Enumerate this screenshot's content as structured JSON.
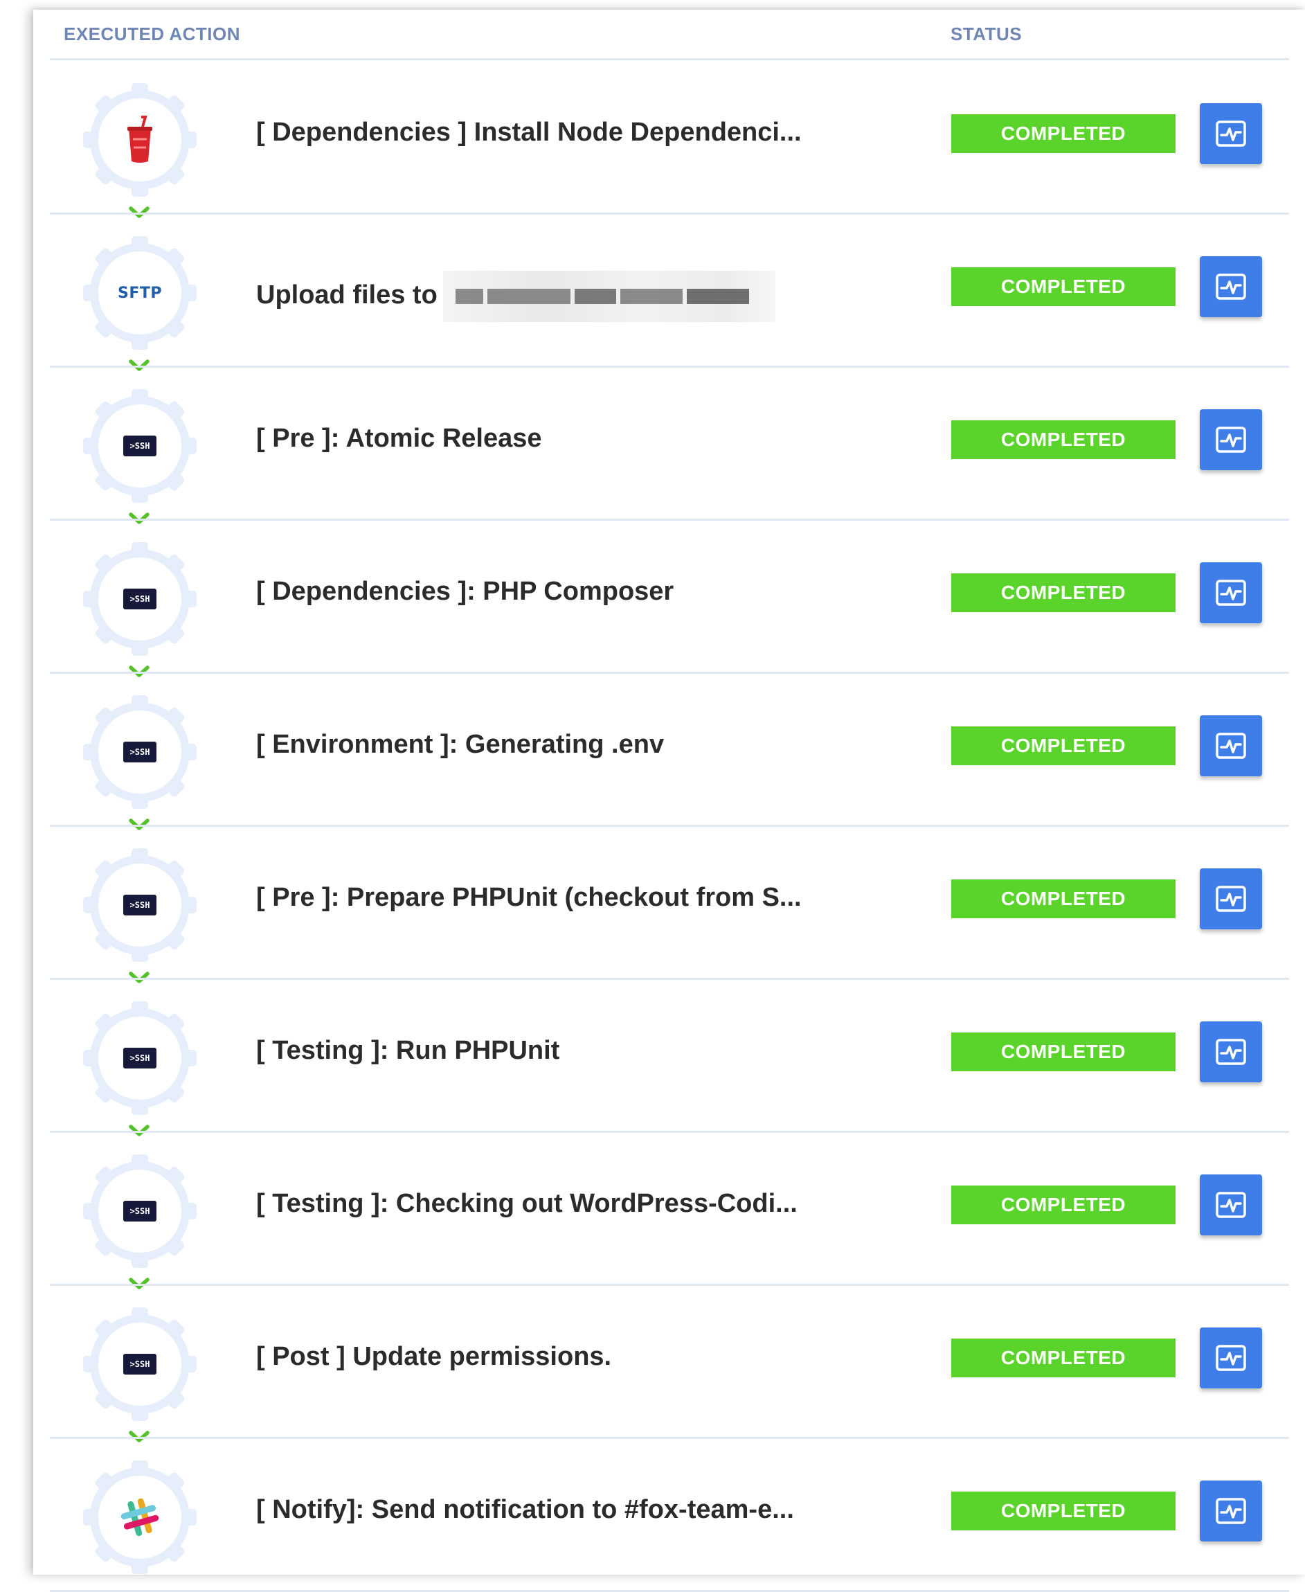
{
  "table": {
    "headers": {
      "executed_action": "EXECUTED ACTION",
      "status": "STATUS"
    },
    "rows": [
      {
        "icon": "gulp-cup-icon",
        "title": "[ Dependencies ] Install Node Dependenci...",
        "status": "COMPLETED"
      },
      {
        "icon": "sftp-icon",
        "icon_text": "SFTP",
        "title": "Upload files to",
        "status": "COMPLETED",
        "redacted": true
      },
      {
        "icon": "ssh-icon",
        "icon_text": ">SSH",
        "title": "[ Pre ]: Atomic Release",
        "status": "COMPLETED"
      },
      {
        "icon": "ssh-icon",
        "icon_text": ">SSH",
        "title": "[ Dependencies ]: PHP Composer",
        "status": "COMPLETED"
      },
      {
        "icon": "ssh-icon",
        "icon_text": ">SSH",
        "title": "[ Environment ]: Generating .env",
        "status": "COMPLETED"
      },
      {
        "icon": "ssh-icon",
        "icon_text": ">SSH",
        "title": "[ Pre ]: Prepare PHPUnit (checkout from S...",
        "status": "COMPLETED"
      },
      {
        "icon": "ssh-icon",
        "icon_text": ">SSH",
        "title": "[ Testing ]: Run PHPUnit",
        "status": "COMPLETED"
      },
      {
        "icon": "ssh-icon",
        "icon_text": ">SSH",
        "title": "[ Testing ]: Checking out WordPress-Codi...",
        "status": "COMPLETED"
      },
      {
        "icon": "ssh-icon",
        "icon_text": ">SSH",
        "title": "[ Post ] Update permissions.",
        "status": "COMPLETED"
      },
      {
        "icon": "slack-icon",
        "title": "[ Notify]: Send notification to #fox-team-e...",
        "status": "COMPLETED"
      }
    ]
  },
  "colors": {
    "completed": "#5ad32a",
    "log_button": "#3f7de8",
    "gear": "#e5eefa",
    "chevron": "#55c22a",
    "header_text": "#6f86b5"
  }
}
